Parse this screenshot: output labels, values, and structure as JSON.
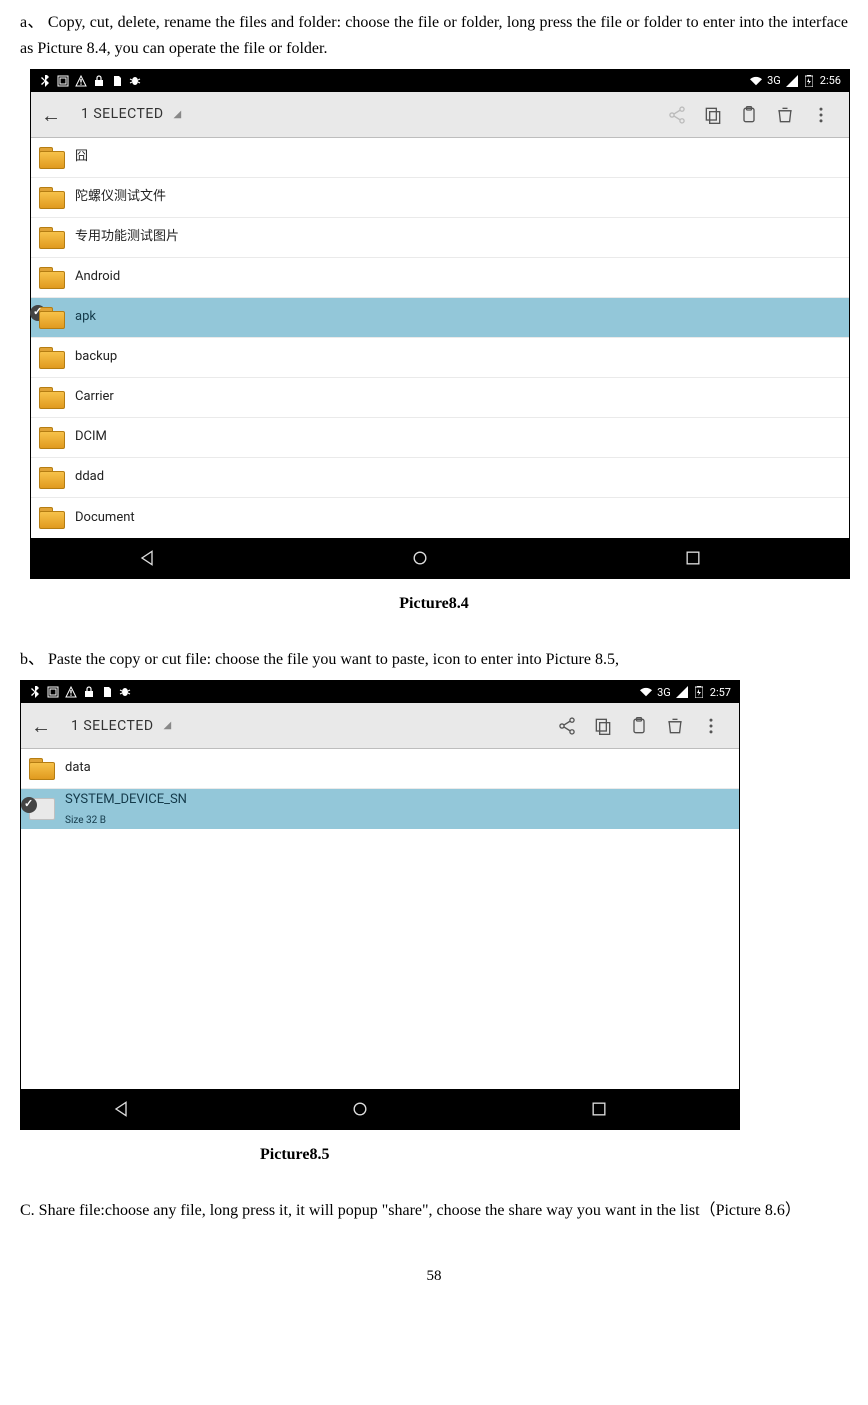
{
  "text": {
    "para_a": "a、 Copy, cut, delete, rename the files and folder: choose the file or folder, long press the file or folder to enter into the interface as Picture 8.4, you can operate the file or folder.",
    "caption_a": "Picture8.4",
    "para_b": "b、 Paste the copy or cut file: choose the file you want to paste,    icon to enter into Picture 8.5,",
    "caption_b": "Picture8.5",
    "para_c": "C. Share file:choose any file, long press it, it will popup \"share\", choose the share way you want in the list（Picture 8.6）",
    "page_num": "58"
  },
  "shot_a": {
    "status": {
      "net": "3G",
      "clock": "2:56"
    },
    "toolbar": {
      "title": "1 SELECTED"
    },
    "items": [
      {
        "name": "囧",
        "selected": false
      },
      {
        "name": "陀螺仪测试文件",
        "selected": false
      },
      {
        "name": "专用功能测试图片",
        "selected": false
      },
      {
        "name": "Android",
        "selected": false
      },
      {
        "name": "apk",
        "selected": true
      },
      {
        "name": "backup",
        "selected": false
      },
      {
        "name": "Carrier",
        "selected": false
      },
      {
        "name": "DCIM",
        "selected": false
      },
      {
        "name": "ddad",
        "selected": false
      },
      {
        "name": "Document",
        "selected": false
      }
    ]
  },
  "shot_b": {
    "status": {
      "net": "3G",
      "clock": "2:57"
    },
    "toolbar": {
      "title": "1 SELECTED"
    },
    "items": [
      {
        "name": "data",
        "type": "folder",
        "selected": false
      },
      {
        "name": "SYSTEM_DEVICE_SN",
        "type": "file",
        "meta": "Size 32 B",
        "selected": true
      }
    ]
  }
}
